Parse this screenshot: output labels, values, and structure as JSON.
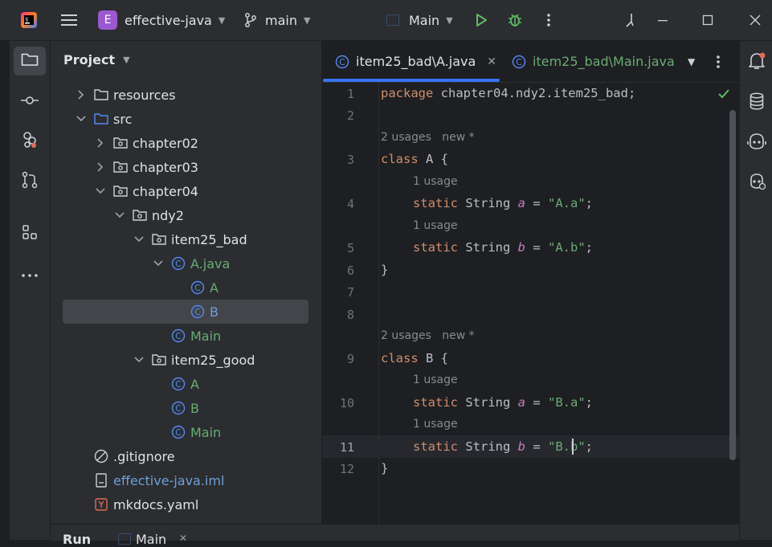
{
  "titlebar": {
    "project_badge": "E",
    "project_name": "effective-java",
    "branch": "main",
    "run_config": "Main"
  },
  "project_panel": {
    "title": "Project",
    "tree": [
      {
        "label": "resources",
        "kind": "folder",
        "expanded": false
      },
      {
        "label": "src",
        "kind": "src-folder",
        "expanded": true
      },
      {
        "label": "chapter02",
        "kind": "package",
        "expanded": false
      },
      {
        "label": "chapter03",
        "kind": "package",
        "expanded": false
      },
      {
        "label": "chapter04",
        "kind": "package",
        "expanded": true
      },
      {
        "label": "ndy2",
        "kind": "package",
        "expanded": true
      },
      {
        "label": "item25_bad",
        "kind": "package",
        "expanded": true
      },
      {
        "label": "A.java",
        "kind": "java-file",
        "expanded": true
      },
      {
        "label": "A",
        "kind": "class"
      },
      {
        "label": "B",
        "kind": "class",
        "selected": true
      },
      {
        "label": "Main",
        "kind": "class"
      },
      {
        "label": "item25_good",
        "kind": "package",
        "expanded": true
      },
      {
        "label": "A",
        "kind": "class"
      },
      {
        "label": "B",
        "kind": "class"
      },
      {
        "label": "Main",
        "kind": "class"
      },
      {
        "label": ".gitignore",
        "kind": "ignore"
      },
      {
        "label": "effective-java.iml",
        "kind": "iml"
      },
      {
        "label": "mkdocs.yaml",
        "kind": "yaml"
      }
    ]
  },
  "editor": {
    "tabs": [
      {
        "label": "item25_bad\\A.java",
        "active": true
      },
      {
        "label": "item25_bad\\Main.java",
        "active": false
      }
    ],
    "line_numbers": [
      "1",
      "2",
      "3",
      "4",
      "5",
      "6",
      "7",
      "8",
      "9",
      "10",
      "11",
      "12"
    ],
    "hints": {
      "class_a_usages": "2 usages",
      "class_a_new": "new *",
      "a_a_usage": "1 usage",
      "a_b_usage": "1 usage",
      "class_b_usages": "2 usages",
      "class_b_new": "new *",
      "b_a_usage": "1 usage",
      "b_b_usage": "1 usage"
    },
    "code": {
      "l1_kw": "package",
      "l1_rest": " chapter04.ndy2.item25_bad;",
      "l3_kw": "class",
      "l3_rest": " A {",
      "l4_kw": "static",
      "l4_type": " String ",
      "l4_field": "a",
      "l4_eq": " = ",
      "l4_str": "\"A.a\"",
      "l4_end": ";",
      "l5_kw": "static",
      "l5_type": " String ",
      "l5_field": "b",
      "l5_eq": " = ",
      "l5_str": "\"A.b\"",
      "l5_end": ";",
      "l6": "}",
      "l9_kw": "class",
      "l9_rest": " B {",
      "l10_kw": "static",
      "l10_type": " String ",
      "l10_field": "a",
      "l10_eq": " = ",
      "l10_str": "\"B.a\"",
      "l10_end": ";",
      "l11_kw": "static",
      "l11_type": " String ",
      "l11_field": "b",
      "l11_eq": " = ",
      "l11_str": "\"B.b\"",
      "l11_end": ";",
      "l12": "}"
    },
    "current_line": "11"
  },
  "bottom": {
    "tool_label": "Run",
    "config_label": "Main"
  },
  "colors": {
    "accent": "#3574f0",
    "keyword": "#cf8e6d",
    "string": "#6aab73",
    "field": "#c77dbb",
    "class_icon": "#548af7",
    "green_run": "#5fb865",
    "badge": "#9b59d0"
  },
  "icons": [
    "app-logo-icon",
    "hamburger-menu-icon",
    "branch-icon",
    "run-config-icon",
    "run-icon",
    "debug-icon",
    "more-icon",
    "minimize-icon",
    "maximize-icon",
    "close-icon",
    "folder-icon",
    "commit-icon",
    "plugins-icon",
    "pull-request-icon",
    "structure-icon",
    "notifications-icon",
    "database-icon",
    "ai-assistant-icon",
    "copilot-icon",
    "checkmark-icon"
  ]
}
